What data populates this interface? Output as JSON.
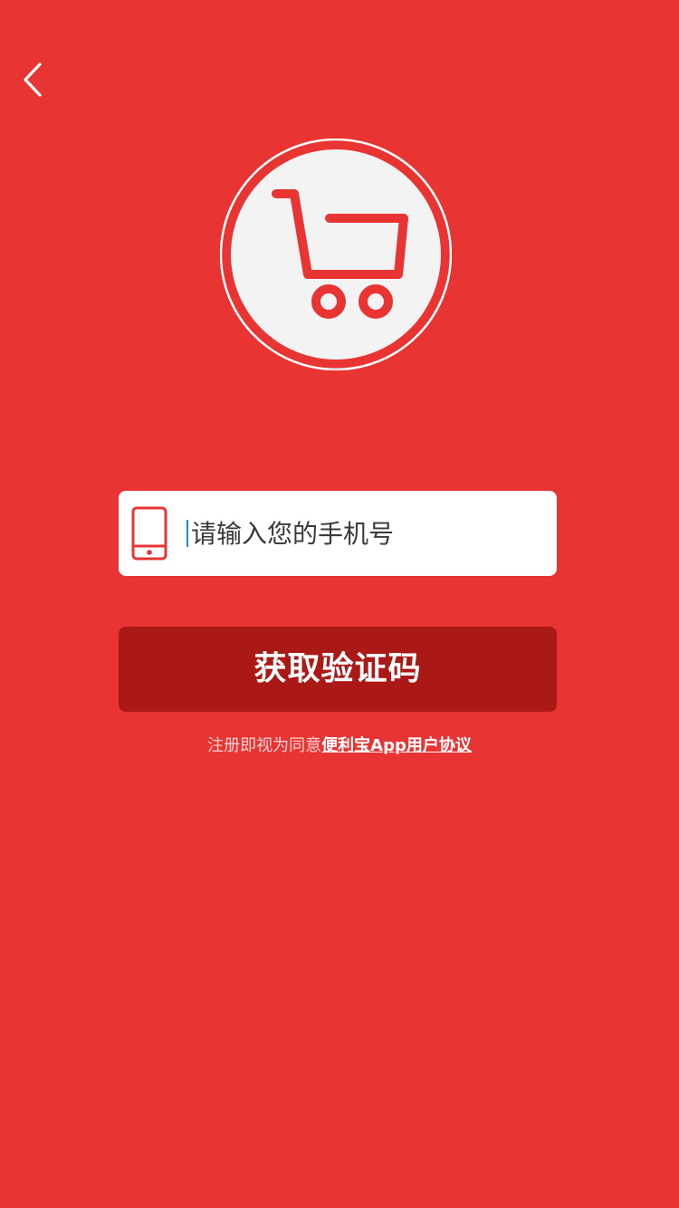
{
  "header": {
    "back_icon": "chevron-left-icon"
  },
  "logo": {
    "icon": "shopping-cart-icon"
  },
  "form": {
    "phone_icon": "mobile-phone-icon",
    "phone_placeholder": "请输入您的手机号",
    "phone_value": "",
    "submit_label": "获取验证码"
  },
  "agreement": {
    "prefix": "注册即视为同意",
    "link_text": "便利宝App用户协议"
  },
  "colors": {
    "background": "#e83534",
    "button": "#ab1916",
    "field": "#ffffff",
    "caret": "#1a8fd6"
  }
}
